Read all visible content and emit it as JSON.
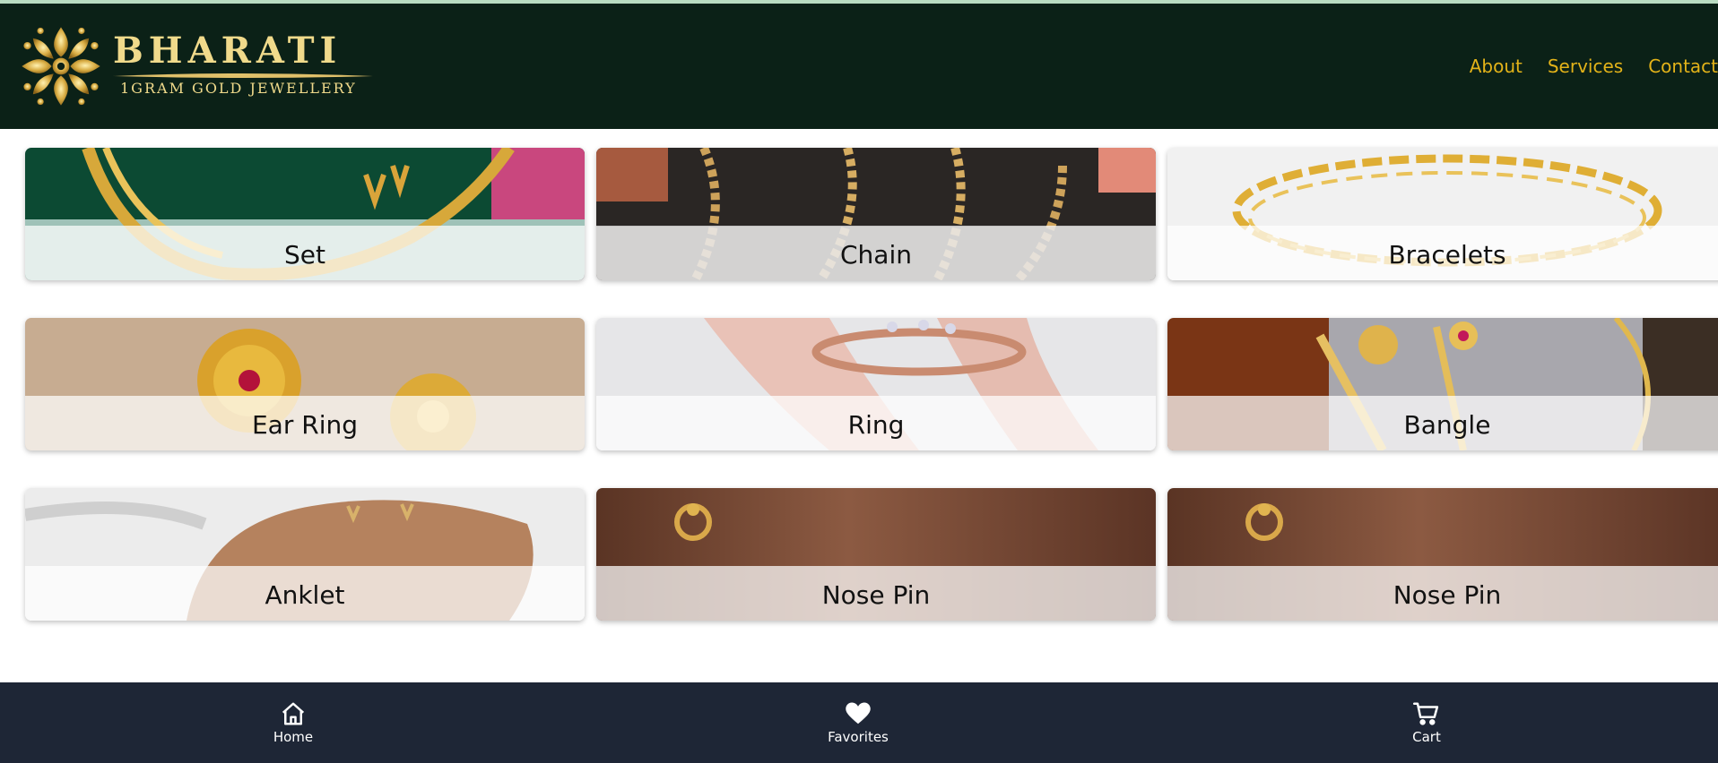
{
  "header": {
    "brand_name": "BHARATI",
    "brand_tagline": "1GRAM GOLD JEWELLERY",
    "logo_icon": "ornament-emblem-icon",
    "nav": [
      {
        "label": "About"
      },
      {
        "label": "Services"
      },
      {
        "label": "Contact"
      }
    ]
  },
  "categories": [
    {
      "label": "Set",
      "image": "gold-necklace-set"
    },
    {
      "label": "Chain",
      "image": "gold-chains"
    },
    {
      "label": "Bracelets",
      "image": "gold-link-bracelet"
    },
    {
      "label": "Ear Ring",
      "image": "gold-earrings"
    },
    {
      "label": "Ring",
      "image": "rose-gold-ring-on-hand"
    },
    {
      "label": "Bangle",
      "image": "gold-bangle"
    },
    {
      "label": "Anklet",
      "image": "anklet-on-foot"
    },
    {
      "label": "Nose Pin",
      "image": "nose-pin-closeup"
    },
    {
      "label": "Nose Pin",
      "image": "nose-pin-closeup"
    }
  ],
  "bottom_nav": [
    {
      "label": "Home",
      "icon": "home-icon"
    },
    {
      "label": "Favorites",
      "icon": "heart-icon"
    },
    {
      "label": "Cart",
      "icon": "cart-icon"
    }
  ],
  "colors": {
    "header_bg": "#0b2117",
    "nav_link": "#e3b319",
    "brand_gold": "#f0da8b",
    "footer_bg": "#1e2636"
  }
}
